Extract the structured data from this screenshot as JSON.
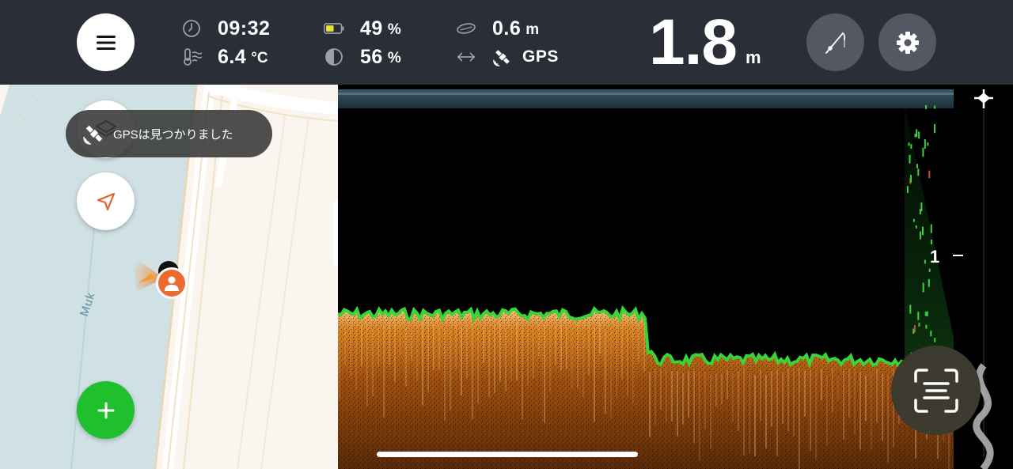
{
  "header": {
    "time": "09:32",
    "water_temp": "6.4",
    "water_temp_unit": "°C",
    "battery": "49",
    "battery_unit": "%",
    "sensitivity": "56",
    "sensitivity_unit": "%",
    "beam_width": "0.6",
    "beam_width_unit": "m",
    "position_source": "GPS",
    "depth": "1.8",
    "depth_unit": "m"
  },
  "map": {
    "river_label": "Muk",
    "toast_text": "GPSは見つかりました"
  },
  "sonar": {
    "scale_label": "1"
  },
  "icons": {
    "menu": "hamburger-menu-icon",
    "clock": "clock-icon",
    "thermometer": "water-temperature-icon",
    "battery": "battery-icon",
    "contrast": "contrast-icon",
    "beam": "beam-ellipse-icon",
    "width": "horizontal-arrows-icon",
    "satellite": "satellite-icon",
    "rod": "fishing-rod-icon",
    "gear": "gear-icon",
    "layers": "layers-icon",
    "navigate": "navigation-arrow-icon",
    "add": "plus-icon",
    "scan": "scan-text-icon"
  },
  "colors": {
    "topbar": "#2a2e37",
    "accent_orange": "#ea6a2f",
    "add_green": "#1fbf2e",
    "battery_fill": "#e5e338",
    "sonar_bottom": "#c86a1a",
    "sonar_edge": "#39d43a"
  }
}
